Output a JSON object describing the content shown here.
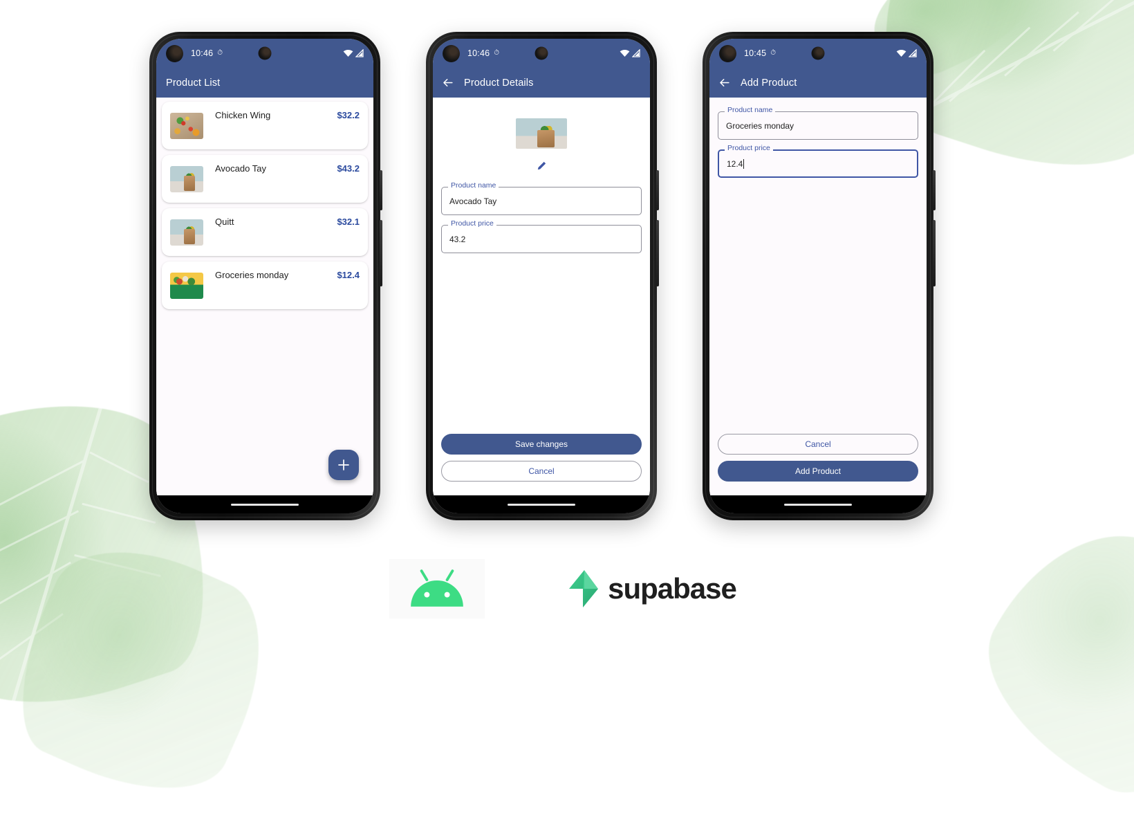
{
  "theme": {
    "appbar_color": "#41588f",
    "accent_color": "#3f56a5",
    "price_color": "#2b4a9e",
    "screen_bg": "#fdfafd",
    "android_green": "#3ddc84",
    "supabase_green": "#3ecf8e"
  },
  "phones": [
    {
      "id": "product-list",
      "status": {
        "time": "10:46",
        "alarm_icon": "alarm-icon",
        "wifi_icon": "wifi-icon",
        "signal_icon": "signal-icon"
      },
      "appbar": {
        "title": "Product List",
        "has_back": false
      },
      "products": [
        {
          "name": "Chicken Wing",
          "price": "$32.2",
          "thumb": "vegetables-on-board-image"
        },
        {
          "name": "Avocado Tay",
          "price": "$43.2",
          "thumb": "grocery-bag-green-door-image"
        },
        {
          "name": "Quitt",
          "price": "$32.1",
          "thumb": "grocery-bag-green-door-image"
        },
        {
          "name": "Groceries monday",
          "price": "$12.4",
          "thumb": "green-bag-yellow-background-image"
        }
      ],
      "fab": {
        "icon": "plus-icon",
        "label": "+"
      }
    },
    {
      "id": "product-details",
      "status": {
        "time": "10:46",
        "alarm_icon": "alarm-icon",
        "wifi_icon": "wifi-icon",
        "signal_icon": "signal-icon"
      },
      "appbar": {
        "title": "Product Details",
        "has_back": true,
        "back_icon": "arrow-left-icon"
      },
      "hero_image": "grocery-bag-green-door-image",
      "edit_icon": "pencil-icon",
      "fields": [
        {
          "label": "Product name",
          "value": "Avocado Tay",
          "focused": false
        },
        {
          "label": "Product price",
          "value": "43.2",
          "focused": false
        }
      ],
      "buttons": [
        {
          "label": "Save changes",
          "style": "filled"
        },
        {
          "label": "Cancel",
          "style": "outline"
        }
      ]
    },
    {
      "id": "add-product",
      "status": {
        "time": "10:45",
        "alarm_icon": "alarm-icon",
        "wifi_icon": "wifi-icon",
        "signal_icon": "signal-icon"
      },
      "appbar": {
        "title": "Add Product",
        "has_back": true,
        "back_icon": "arrow-left-icon"
      },
      "fields": [
        {
          "label": "Product name",
          "value": "Groceries monday",
          "focused": false
        },
        {
          "label": "Product price",
          "value": "12.4",
          "focused": true
        }
      ],
      "buttons": [
        {
          "label": "Cancel",
          "style": "outline"
        },
        {
          "label": "Add Product",
          "style": "filled"
        }
      ]
    }
  ],
  "footer": {
    "android_logo": "android-robot-logo",
    "supabase_logo": "supabase-bolt-logo",
    "supabase_wordmark": "supabase"
  }
}
